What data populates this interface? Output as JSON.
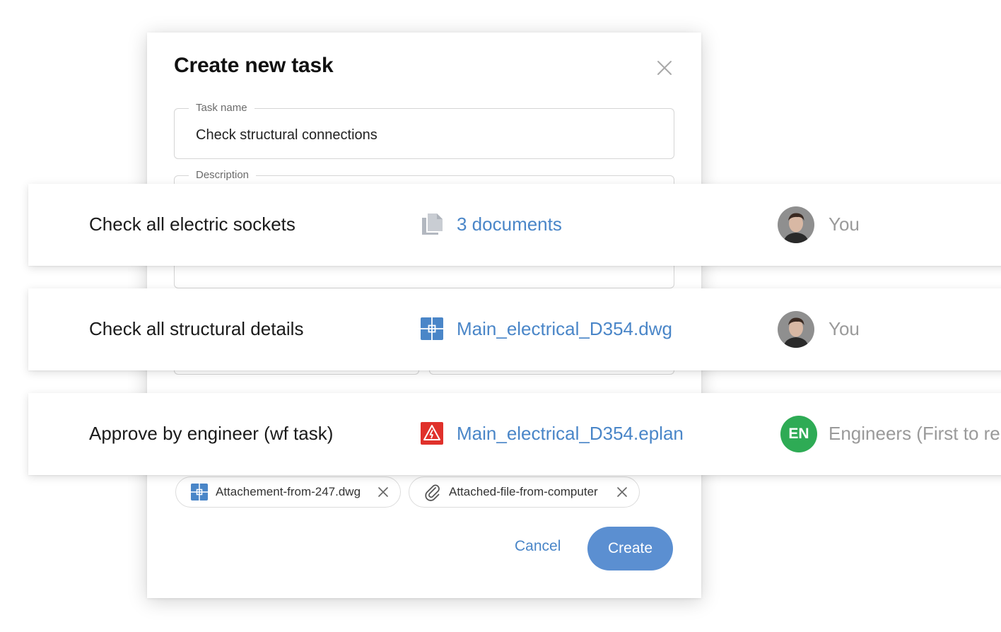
{
  "modal": {
    "title": "Create new task",
    "task_name_label": "Task name",
    "task_name_value": "Check structural connections",
    "description_label": "Description",
    "attachments": [
      {
        "label": "Attachement-from-247.dwg",
        "icon": "dwg-file-icon"
      },
      {
        "label": "Attached-file-from-computer",
        "icon": "paperclip-icon"
      }
    ],
    "cancel_label": "Cancel",
    "create_label": "Create"
  },
  "tasks": [
    {
      "title": "Check all electric sockets",
      "doc_label": "3 documents",
      "doc_icon": "documents-stack-icon",
      "assignee": "You",
      "avatar": "user-avatar"
    },
    {
      "title": "Check all structural details",
      "doc_label": "Main_electrical_D354.dwg",
      "doc_icon": "dwg-file-icon",
      "assignee": "You",
      "avatar": "user-avatar"
    },
    {
      "title": "Approve by engineer (wf task)",
      "doc_label": "Main_electrical_D354.eplan",
      "doc_icon": "eplan-file-icon",
      "assignee": "Engineers (First to re",
      "avatar_initials": "EN"
    }
  ],
  "colors": {
    "link": "#4a86c8",
    "primary_button": "#5b8fd1",
    "group_avatar": "#2eab55",
    "eplan_red": "#e0312b",
    "dwg_blue": "#4a86c8"
  }
}
